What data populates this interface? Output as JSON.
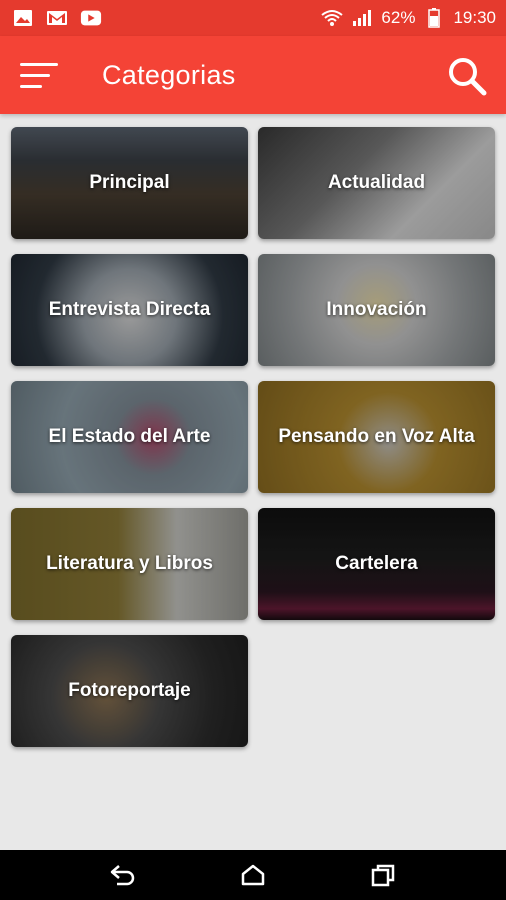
{
  "status_bar": {
    "battery": "62%",
    "time": "19:30",
    "left_icons": [
      "gallery-icon",
      "gmail-icon",
      "youtube-icon"
    ],
    "right_icons": [
      "wifi-icon",
      "signal-icon",
      "battery-icon"
    ]
  },
  "app_bar": {
    "title": "Categorias",
    "color": "#f44336"
  },
  "categories": [
    {
      "label": "Principal",
      "theme": "city"
    },
    {
      "label": "Actualidad",
      "theme": "desk"
    },
    {
      "label": "Entrevista Directa",
      "theme": "interview"
    },
    {
      "label": "Innovación",
      "theme": "bulb"
    },
    {
      "label": "El Estado del Arte",
      "theme": "art"
    },
    {
      "label": "Pensando en Voz Alta",
      "theme": "thinking"
    },
    {
      "label": "Literatura y Libros",
      "theme": "books"
    },
    {
      "label": "Cartelera",
      "theme": "billboard"
    },
    {
      "label": "Fotoreportaje",
      "theme": "camera"
    }
  ],
  "nav_bar": {
    "buttons": [
      "back-icon",
      "home-icon",
      "recents-icon"
    ]
  }
}
